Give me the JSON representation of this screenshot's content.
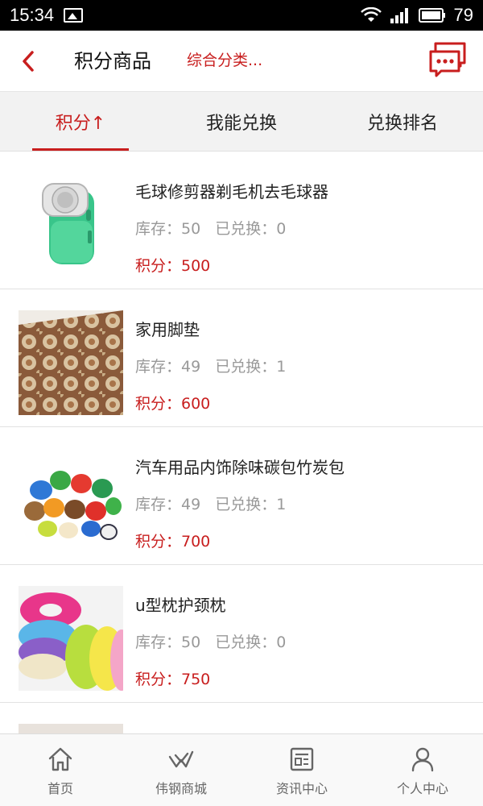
{
  "status_bar": {
    "time": "15:34",
    "battery": "79"
  },
  "header": {
    "title": "积分商品",
    "category": "综合分类..."
  },
  "tabs": [
    {
      "label": "积分↑",
      "active": true
    },
    {
      "label": "我能兑换",
      "active": false
    },
    {
      "label": "兑换排名",
      "active": false
    }
  ],
  "items": [
    {
      "title": "毛球修剪器剃毛机去毛球器",
      "stock": "库存：50   已兑换：0",
      "points": "积分：500"
    },
    {
      "title": "家用脚垫",
      "stock": "库存：49   已兑换：1",
      "points": "积分：600"
    },
    {
      "title": "汽车用品内饰除味碳包竹炭包",
      "stock": "库存：49   已兑换：1",
      "points": "积分：700"
    },
    {
      "title": "u型枕护颈枕",
      "stock": "库存：50   已兑换：0",
      "points": "积分：750"
    }
  ],
  "bottom_nav": [
    {
      "label": "首页",
      "icon": "home-icon"
    },
    {
      "label": "伟钢商城",
      "icon": "shop-icon"
    },
    {
      "label": "资讯中心",
      "icon": "news-icon"
    },
    {
      "label": "个人中心",
      "icon": "user-icon"
    }
  ],
  "colors": {
    "accent": "#c81e1e",
    "text_muted": "#999999"
  }
}
